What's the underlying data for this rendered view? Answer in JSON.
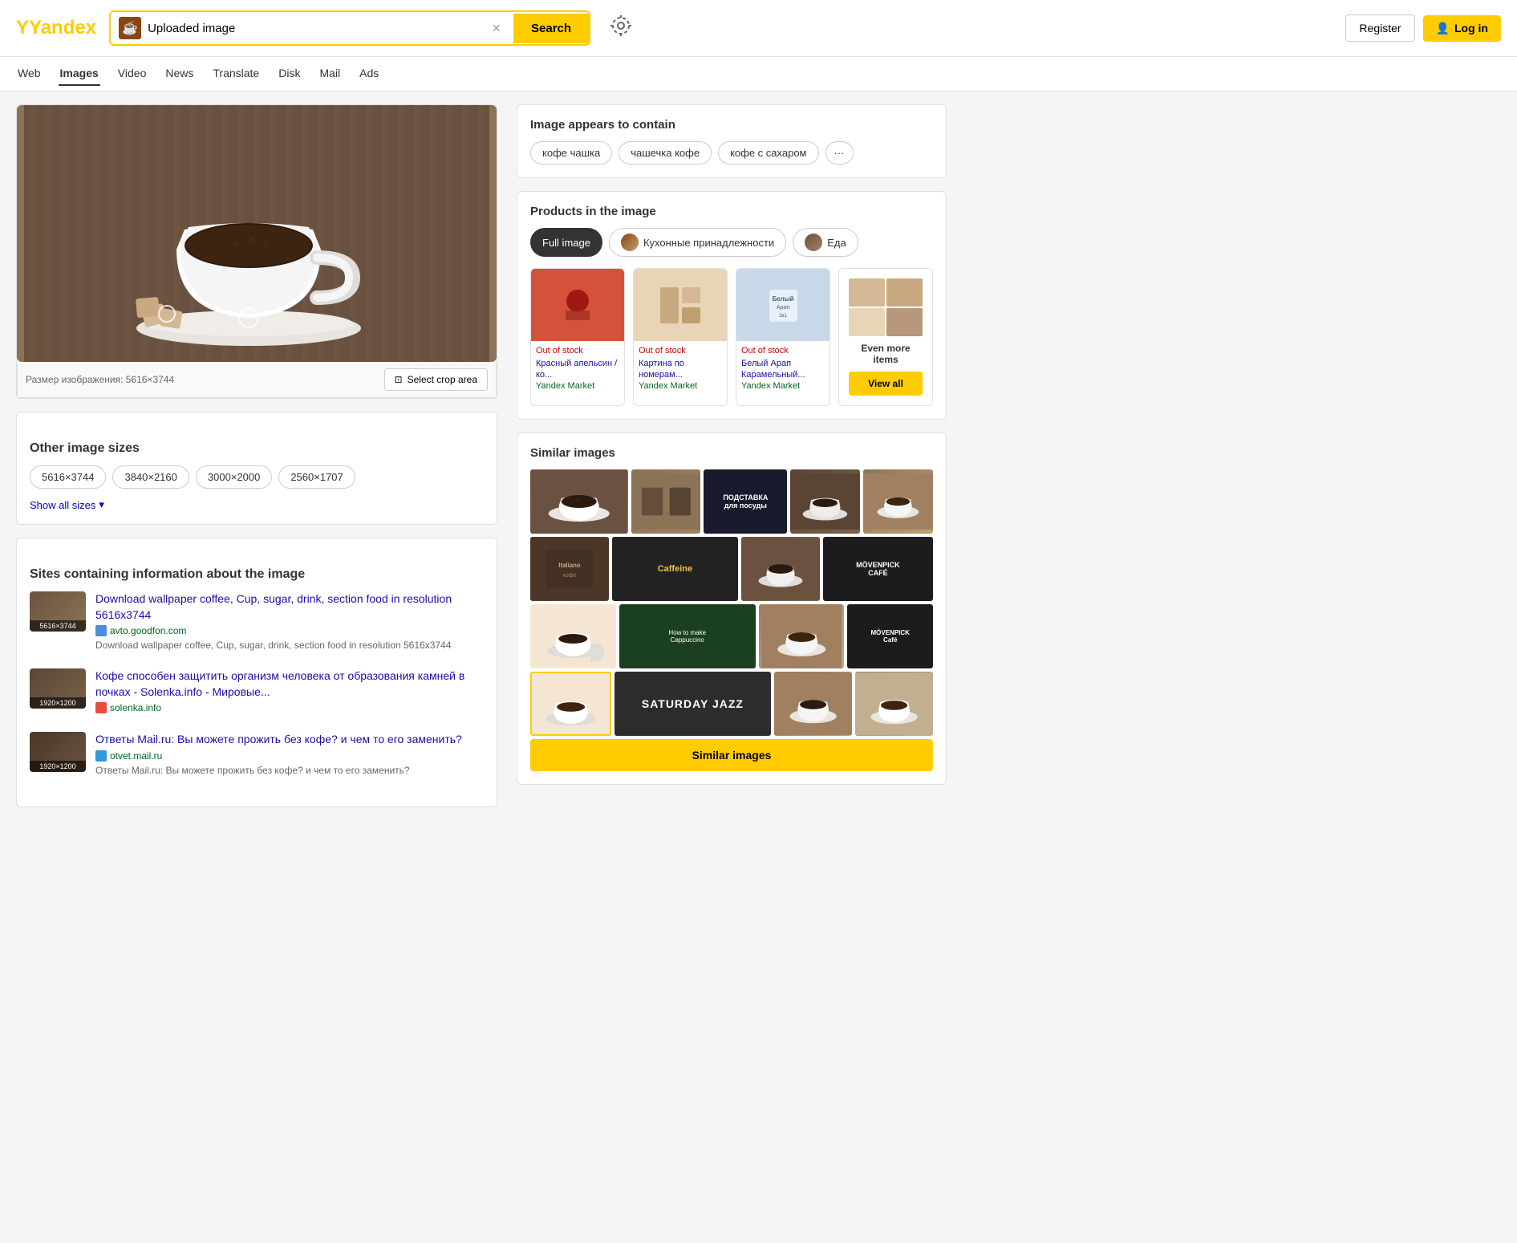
{
  "header": {
    "logo": "Yandex",
    "search_value": "Uploaded image",
    "search_placeholder": "Search",
    "search_btn_label": "Search",
    "clear_btn": "×",
    "register_label": "Register",
    "login_label": "Log in"
  },
  "nav": {
    "items": [
      {
        "label": "Web",
        "active": false
      },
      {
        "label": "Images",
        "active": true
      },
      {
        "label": "Video",
        "active": false
      },
      {
        "label": "News",
        "active": false
      },
      {
        "label": "Translate",
        "active": false
      },
      {
        "label": "Disk",
        "active": false
      },
      {
        "label": "Mail",
        "active": false
      },
      {
        "label": "Ads",
        "active": false
      }
    ]
  },
  "image_info": {
    "caption": "Размер изображения: 5616×3744",
    "crop_btn": "Select crop area"
  },
  "other_sizes": {
    "title": "Other image sizes",
    "sizes": [
      "5616×3744",
      "3840×2160",
      "3000×2000",
      "2560×1707"
    ],
    "show_all": "Show all sizes"
  },
  "sites_section": {
    "title": "Sites containing information about the image",
    "items": [
      {
        "thumb_label": "5616×3744",
        "link": "Download wallpaper coffee, Cup, sugar, drink, section food in resolution 5616x3744",
        "domain": "avto.goodfon.com",
        "desc": "Download wallpaper coffee, Cup, sugar, drink, section food in resolution 5616x3744"
      },
      {
        "thumb_label": "1920×1200",
        "link": "Кофе способен защитить организм человека от образования камней в почках - Solenka.info - Мировые...",
        "domain": "solenka.info",
        "desc": ""
      },
      {
        "thumb_label": "1920×1200",
        "link": "Ответы Mail.ru: Вы можете прожить без кофе? и чем то его заменить?",
        "domain": "otvet.mail.ru",
        "desc": "Ответы Mail.ru: Вы можете прожить без кофе? и чем то его заменить?"
      }
    ]
  },
  "contains": {
    "title": "Image appears to contain",
    "tags": [
      "кофе чашка",
      "чашечка кофе",
      "кофе с сахаром"
    ],
    "more": "···"
  },
  "products": {
    "title": "Products in the image",
    "tabs": [
      {
        "label": "Full image",
        "active": true
      },
      {
        "label": "Кухонные принадлежности",
        "active": false
      },
      {
        "label": "Еда",
        "active": false
      }
    ],
    "items": [
      {
        "status": "Out of stock",
        "name": "Красный апельсин / ко...",
        "store": "Yandex Market"
      },
      {
        "status": "Out of stock",
        "name": "Картина по номерам...",
        "store": "Yandex Market"
      },
      {
        "status": "Out of stock",
        "name": "Белый Арап Карамельный...",
        "store": "Yandex Market"
      },
      {
        "status": "Even more items",
        "view_all": "View all"
      }
    ]
  },
  "similar": {
    "title": "Similar images",
    "btn_label": "Similar images",
    "labels": {
      "подставка": "ПОДСТАВКА",
      "caffeine": "Caffeine",
      "movenpick1": "MÖVENPICK CAFÉ",
      "movenpick2": "MÖVENPICK Café",
      "saturday": "SATURDAY JAZZ",
      "cappuccino": "How to make Cappuccino",
      "italiano": "Italiano кофе"
    }
  }
}
